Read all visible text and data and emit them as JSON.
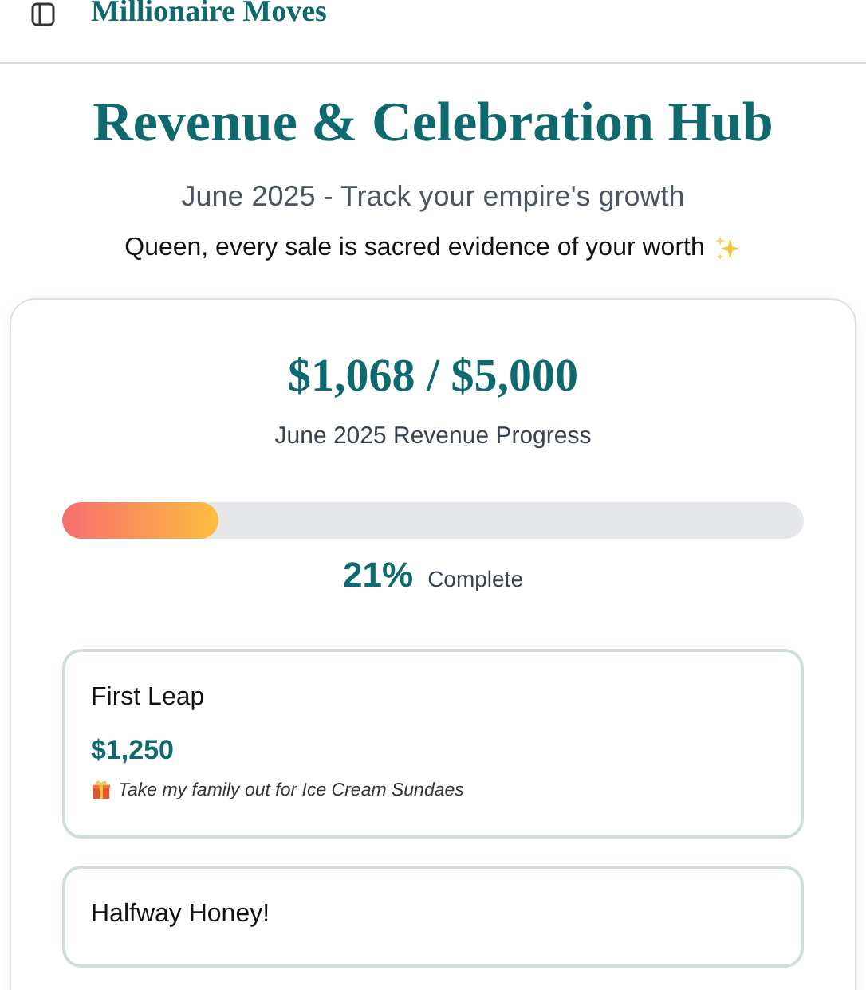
{
  "header": {
    "app_title": "Millionaire Moves"
  },
  "hero": {
    "title": "Revenue & Celebration Hub",
    "subtitle": "June 2025 - Track your empire's growth",
    "tagline": "Queen, every sale is sacred evidence of your worth"
  },
  "progress": {
    "amount": "$1,068 / $5,000",
    "label": "June 2025 Revenue Progress",
    "level": 0.21,
    "percent": "21%",
    "percent_label": "Complete"
  },
  "milestones": [
    {
      "title": "First Leap",
      "amount": "$1,250",
      "reward": "Take my family out for Ice Cream Sundaes"
    },
    {
      "title": "Halfway Honey!"
    }
  ]
}
